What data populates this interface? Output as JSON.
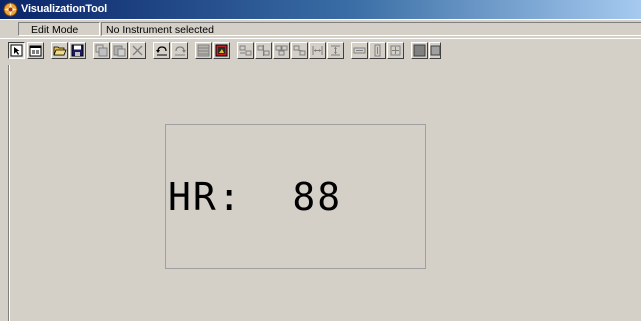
{
  "window": {
    "title": "VisualizationTool"
  },
  "status": {
    "mode": "Edit Mode",
    "instrument": "No Instrument selected"
  },
  "toolbar": {
    "buttons": [
      "select-tool",
      "properties",
      "open-file",
      "save-file",
      "copy",
      "paste",
      "delete",
      "undo",
      "redo",
      "grid",
      "background-image",
      "align-left",
      "align-center",
      "align-right",
      "align-top",
      "align-middle",
      "align-bottom",
      "same-width",
      "same-height",
      "same-size",
      "fill-color",
      "border-style"
    ]
  },
  "instrument": {
    "label": "HR:",
    "value": "88",
    "text": "HR:  88"
  }
}
